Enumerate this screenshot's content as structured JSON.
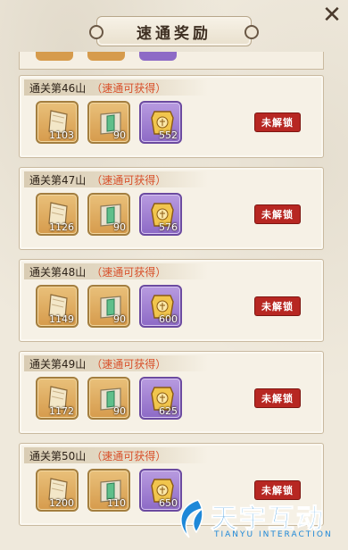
{
  "title": "速通奖励",
  "cards": [
    {
      "heading": "通关第46山",
      "subheading": "（速通可获得）",
      "lock": "未解锁",
      "items": [
        {
          "icon": "scroll-icon",
          "qty": "1103",
          "rarity": "orange"
        },
        {
          "icon": "ticket-icon",
          "qty": "90",
          "rarity": "orange"
        },
        {
          "icon": "gold-plaque-icon",
          "qty": "552",
          "rarity": "purple"
        }
      ]
    },
    {
      "heading": "通关第47山",
      "subheading": "（速通可获得）",
      "lock": "未解锁",
      "items": [
        {
          "icon": "scroll-icon",
          "qty": "1126",
          "rarity": "orange"
        },
        {
          "icon": "ticket-icon",
          "qty": "90",
          "rarity": "orange"
        },
        {
          "icon": "gold-plaque-icon",
          "qty": "576",
          "rarity": "purple"
        }
      ]
    },
    {
      "heading": "通关第48山",
      "subheading": "（速通可获得）",
      "lock": "未解锁",
      "items": [
        {
          "icon": "scroll-icon",
          "qty": "1149",
          "rarity": "orange"
        },
        {
          "icon": "ticket-icon",
          "qty": "90",
          "rarity": "orange"
        },
        {
          "icon": "gold-plaque-icon",
          "qty": "600",
          "rarity": "purple"
        }
      ]
    },
    {
      "heading": "通关第49山",
      "subheading": "（速通可获得）",
      "lock": "未解锁",
      "items": [
        {
          "icon": "scroll-icon",
          "qty": "1172",
          "rarity": "orange"
        },
        {
          "icon": "ticket-icon",
          "qty": "90",
          "rarity": "orange"
        },
        {
          "icon": "gold-plaque-icon",
          "qty": "625",
          "rarity": "purple"
        }
      ]
    },
    {
      "heading": "通关第50山",
      "subheading": "（速通可获得）",
      "lock": "未解锁",
      "items": [
        {
          "icon": "scroll-icon",
          "qty": "1200",
          "rarity": "orange"
        },
        {
          "icon": "ticket-icon",
          "qty": "110",
          "rarity": "orange"
        },
        {
          "icon": "gold-plaque-icon",
          "qty": "650",
          "rarity": "purple"
        }
      ]
    }
  ],
  "watermark": {
    "main": "天宇互动",
    "sub": "TIANYU INTERACTION"
  },
  "colors": {
    "accent_red": "#d8502a",
    "lock_red": "#b72722",
    "watermark_blue": "#1e88d8"
  }
}
